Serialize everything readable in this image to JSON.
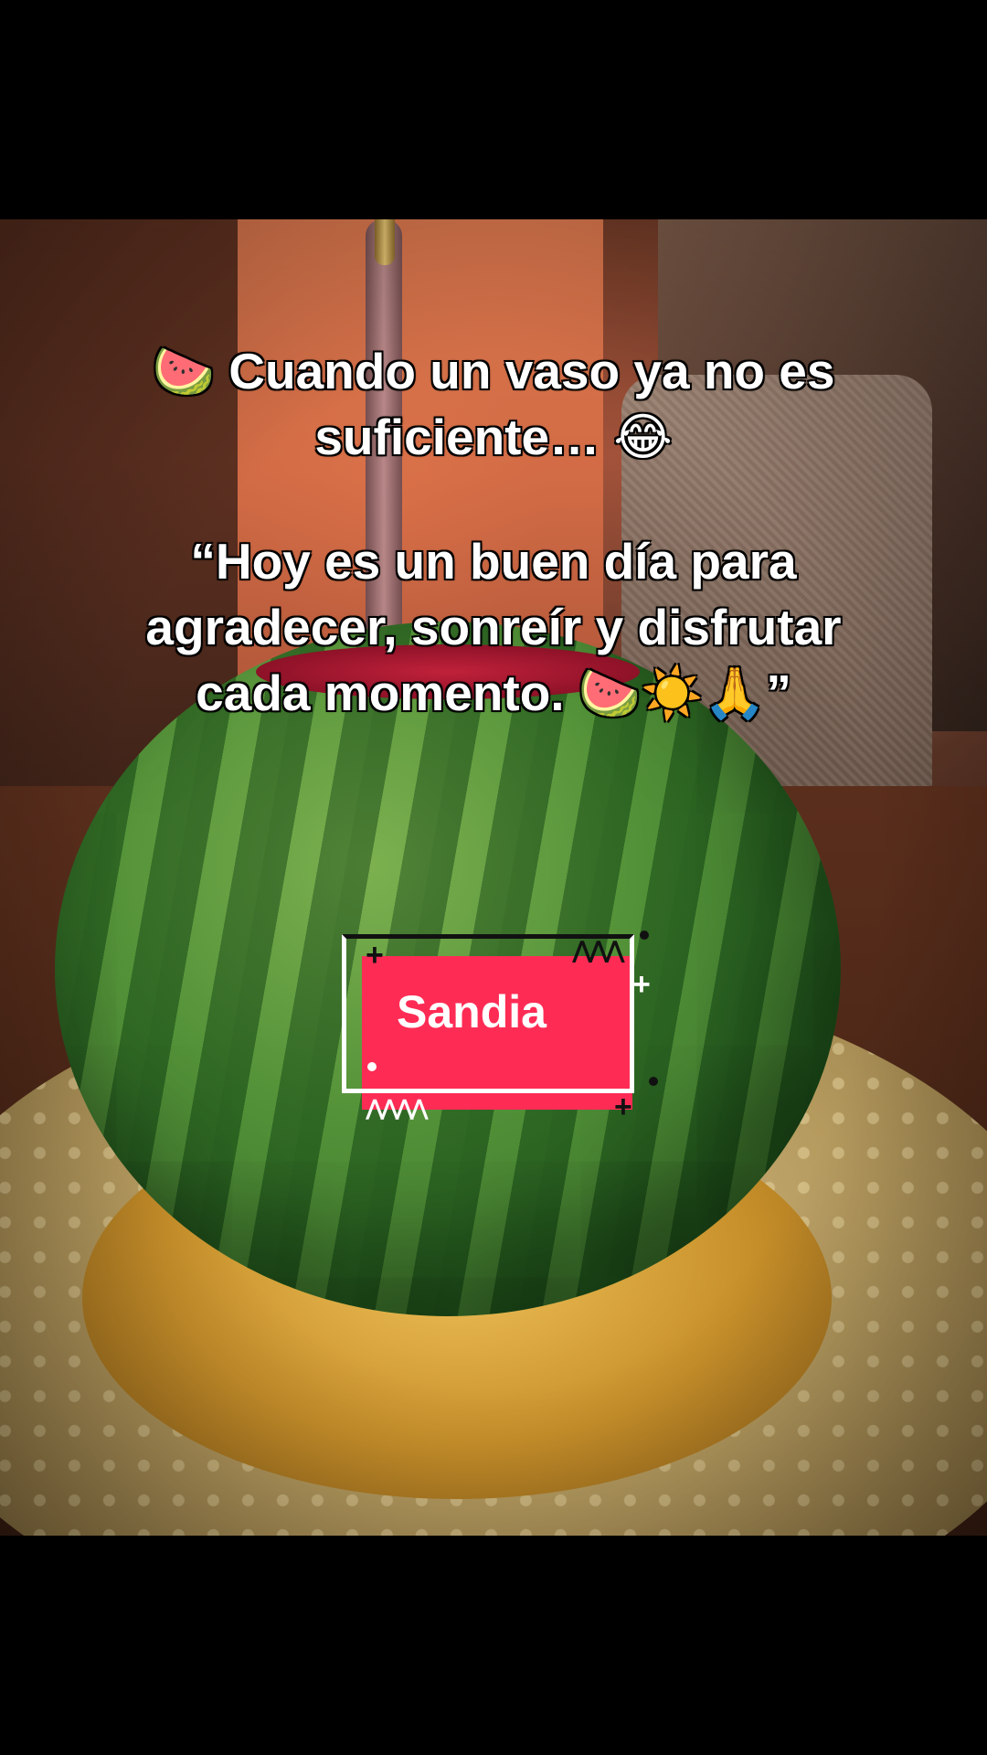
{
  "caption": {
    "line1_emoji": "🍉",
    "line1_text": " Cuando un vaso ya no es",
    "line2_text": "suficiente… ",
    "line2_emoji": "😂",
    "quote_line1": "“Hoy es un buen día para",
    "quote_line2": "agradecer, sonreír y disfrutar",
    "quote_line3_text": "cada momento. ",
    "quote_line3_emoji": "🍉☀️🙏",
    "quote_line3_close": "”"
  },
  "sticker": {
    "label": "Sandia",
    "color": "#fe2c55",
    "decorations": [
      "plus-icon",
      "zigzag-icon",
      "plus-icon",
      "plus-icon",
      "zigzag-icon",
      "dot-icon"
    ]
  }
}
